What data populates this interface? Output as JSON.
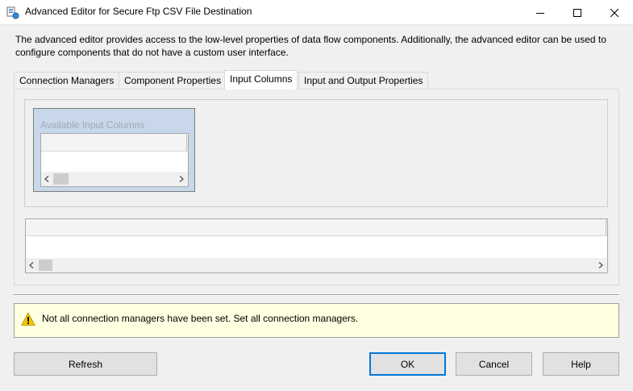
{
  "window": {
    "title": "Advanced Editor for Secure Ftp CSV File Destination",
    "controls": {
      "minimize": "minimize-icon",
      "maximize": "maximize-icon",
      "close": "close-icon"
    }
  },
  "description": "The advanced editor provides access to the low-level properties of data flow components. Additionally, the advanced editor can be used to configure components that do not have a custom user interface.",
  "tabs": [
    {
      "label": "Connection Managers",
      "active": false
    },
    {
      "label": "Component Properties",
      "active": false
    },
    {
      "label": "Input Columns",
      "active": true
    },
    {
      "label": "Input and Output Properties",
      "active": false
    }
  ],
  "input_columns": {
    "available_title": "Available Input Columns"
  },
  "warning": {
    "icon": "warning-icon",
    "text": "Not all connection managers have been set. Set all connection managers."
  },
  "buttons": {
    "refresh": "Refresh",
    "ok": "OK",
    "cancel": "Cancel",
    "help": "Help"
  },
  "colors": {
    "accent": "#0078d7",
    "warning_bg": "#ffffe1",
    "warning_icon": "#f7c600",
    "available_box": "#c8d8ea"
  }
}
